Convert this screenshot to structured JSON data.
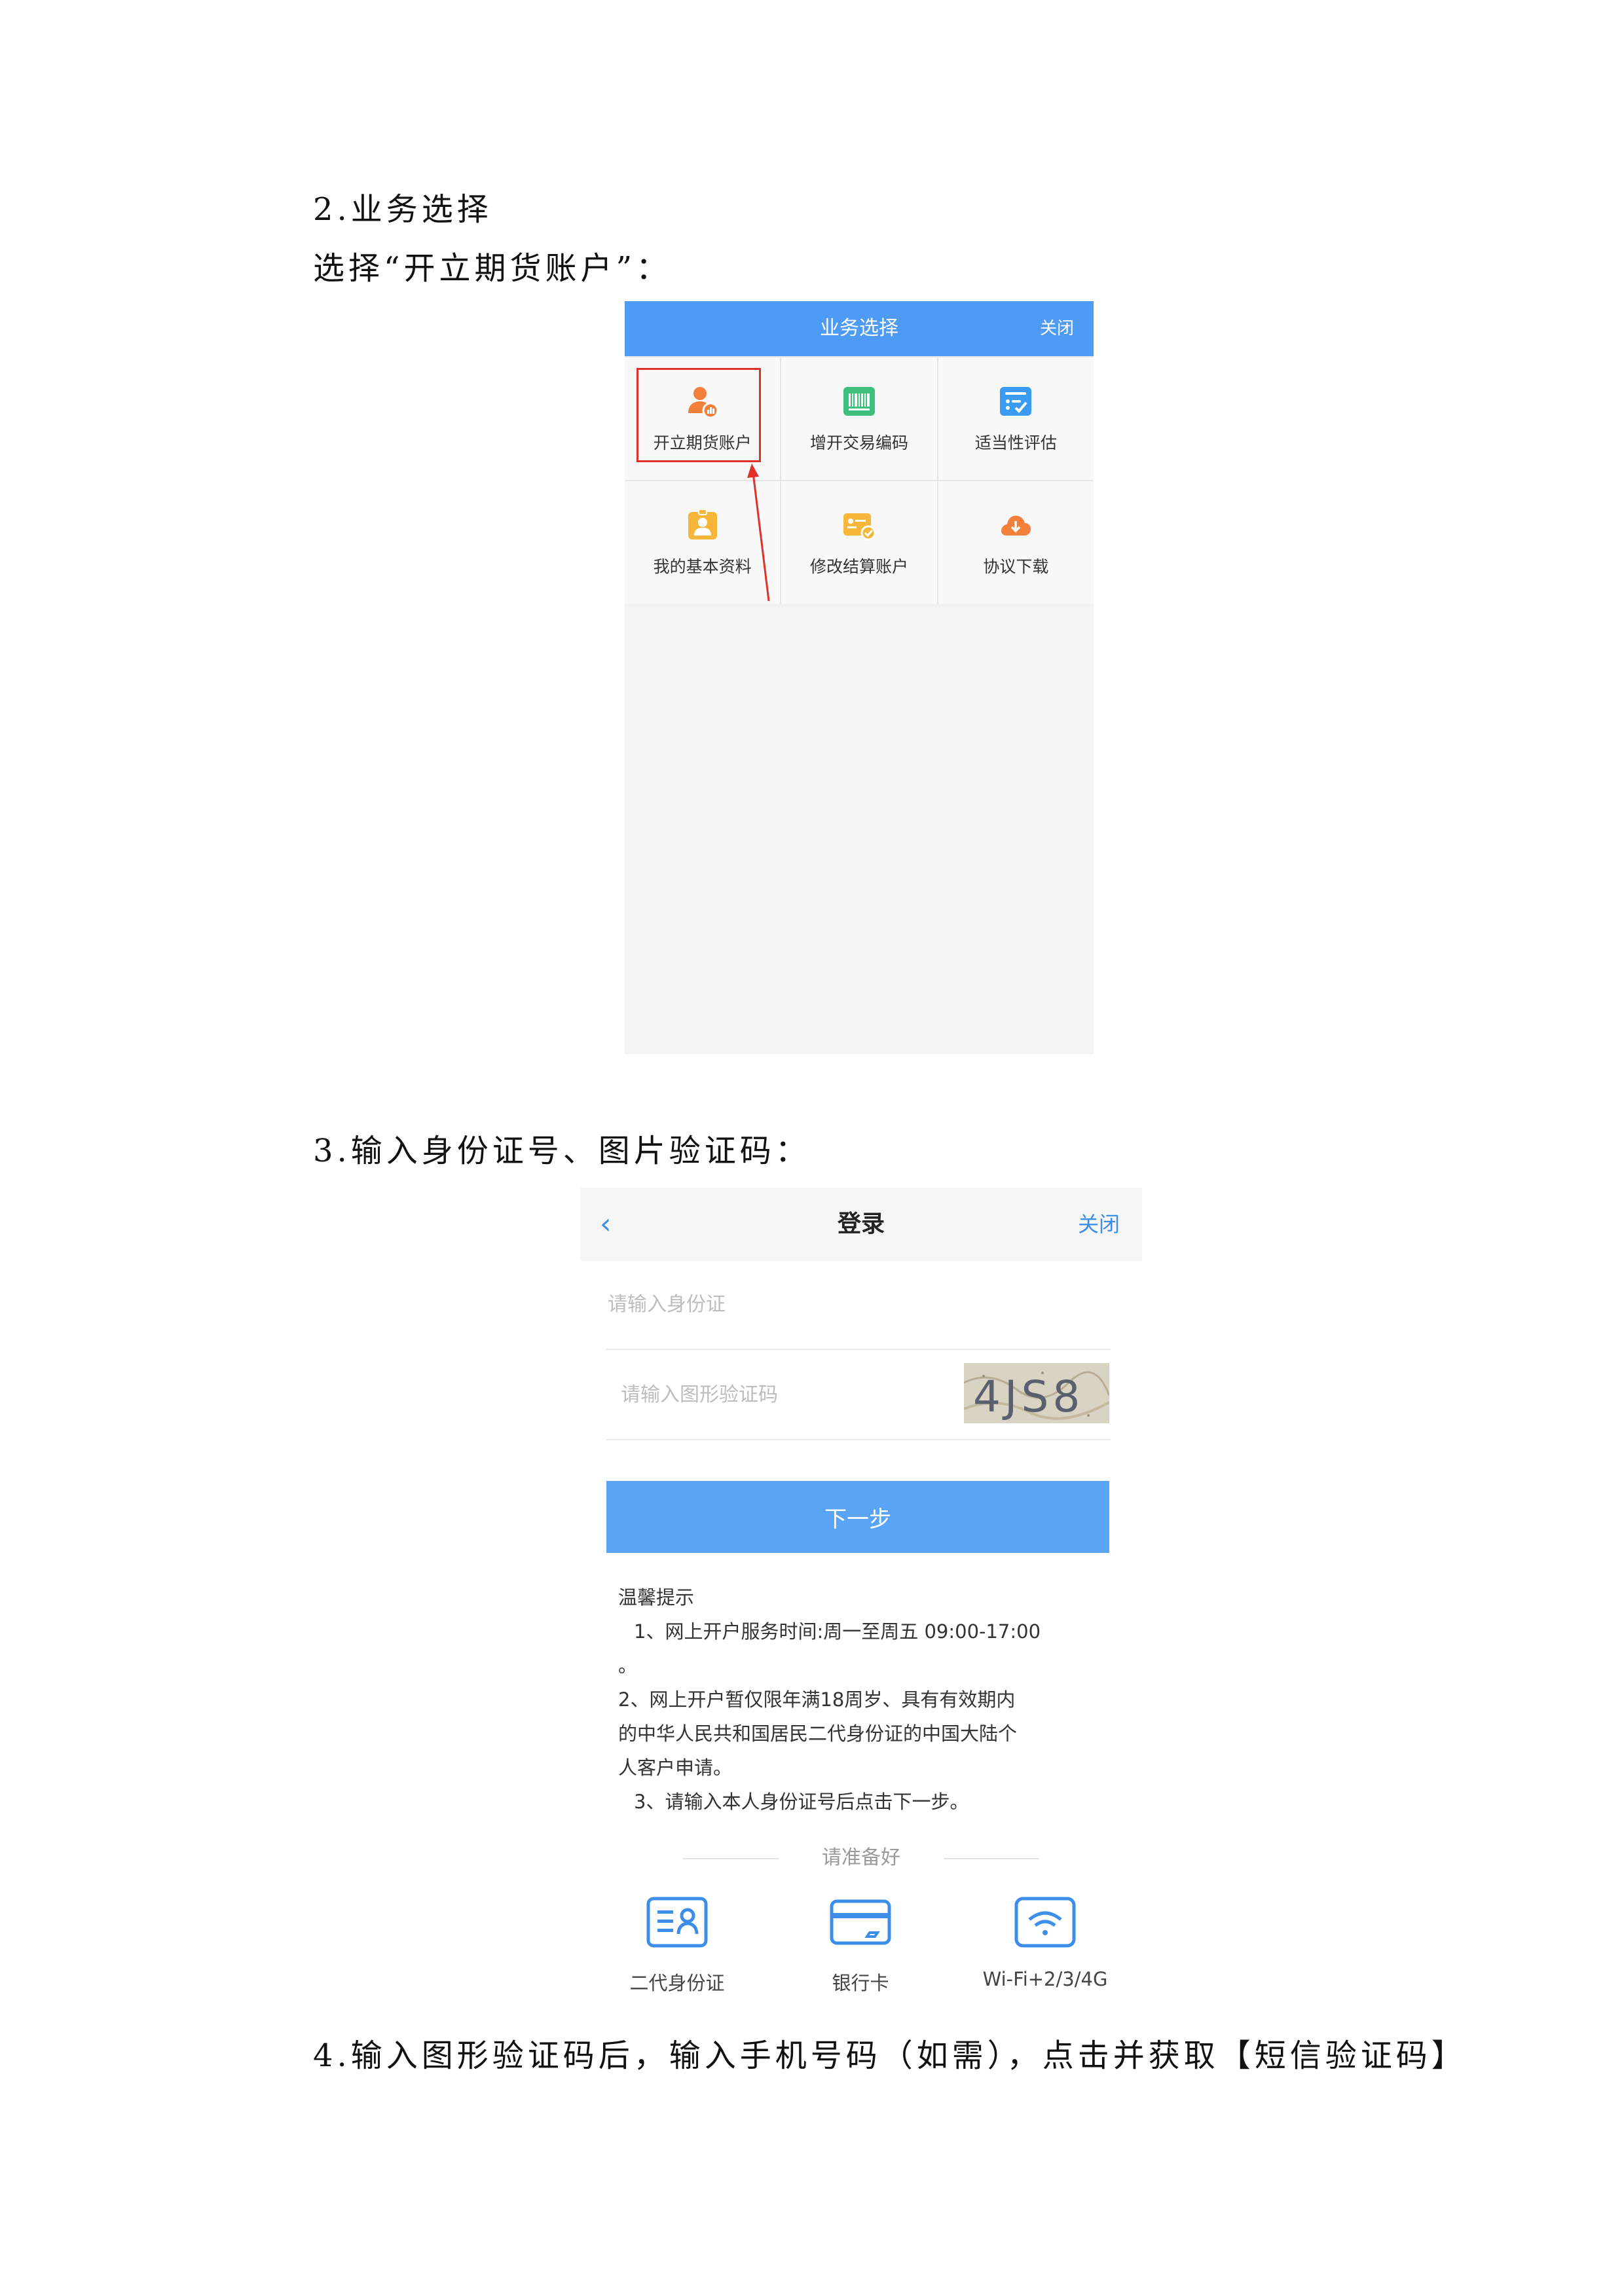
{
  "doc": {
    "step2_heading": "2.业务选择",
    "step2_instruction": "选择“开立期货账户”：",
    "step3_heading": "3.输入身份证号、图片验证码：",
    "step4_heading": "4.输入图形验证码后，输入手机号码（如需），点击并获取【短信验证码】"
  },
  "screen1": {
    "title": "业务选择",
    "close_label": "关闭",
    "tiles": [
      {
        "label": "开立期货账户",
        "icon": "person-chart-icon",
        "color": "#f2803a"
      },
      {
        "label": "增开交易编码",
        "icon": "barcode-icon",
        "color": "#3ec07a"
      },
      {
        "label": "适当性评估",
        "icon": "checklist-icon",
        "color": "#3a9bf0"
      },
      {
        "label": "我的基本资料",
        "icon": "id-badge-icon",
        "color": "#f5b63a"
      },
      {
        "label": "修改结算账户",
        "icon": "card-check-icon",
        "color": "#f5b63a"
      },
      {
        "label": "协议下载",
        "icon": "cloud-download-icon",
        "color": "#f2803a"
      }
    ],
    "highlight_color": "#e0302a"
  },
  "screen2": {
    "back_icon": "chevron-left-icon",
    "title": "登录",
    "close_label": "关闭",
    "id_placeholder": "请输入身份证",
    "captcha_placeholder": "请输入图形验证码",
    "captcha_text": "4JS8",
    "next_label": "下一步",
    "tips_title": "温馨提示",
    "tips": [
      "1、网上开户服务时间:周一至周五 09:00-17:00",
      "。",
      "2、网上开户暂仅限年满18周岁、具有有效期内",
      "的中华人民共和国居民二代身份证的中国大陆个",
      "人客户申请。",
      "3、请输入本人身份证号后点击下一步。"
    ],
    "prepare_label": "请准备好",
    "prepare_items": [
      {
        "label": "二代身份证",
        "icon": "id-card-icon"
      },
      {
        "label": "银行卡",
        "icon": "bank-card-icon"
      },
      {
        "label": "Wi-Fi+2/3/4G",
        "icon": "wifi-icon"
      }
    ],
    "accent": "#3d8ee8"
  }
}
